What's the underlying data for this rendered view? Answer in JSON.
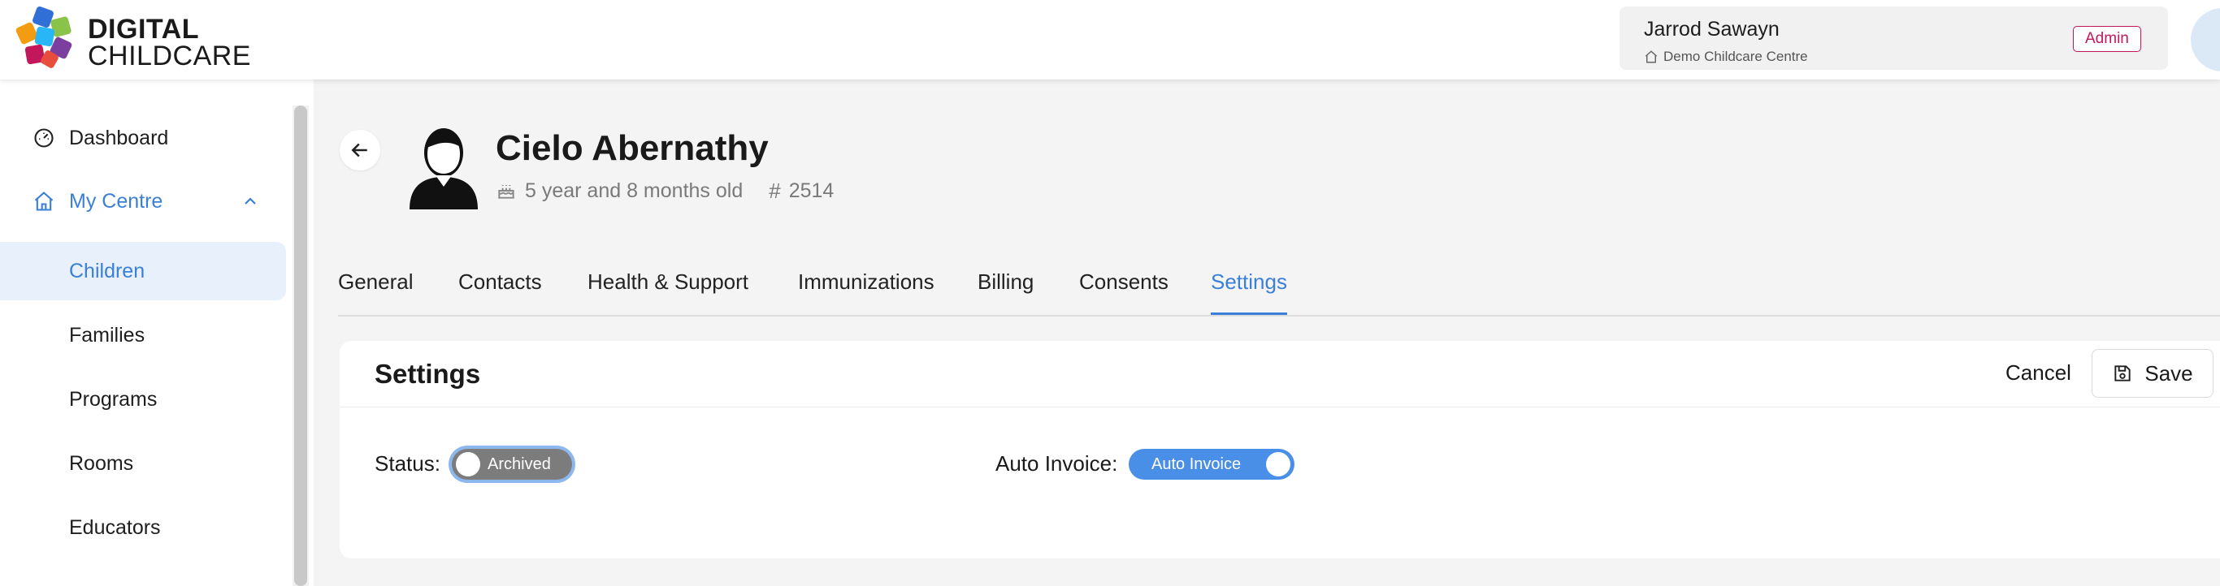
{
  "brand": {
    "line1": "DIGITAL",
    "line2": "CHILDCARE"
  },
  "user": {
    "name": "Jarrod Sawayn",
    "centre": "Demo Childcare Centre",
    "role": "Admin"
  },
  "sidebar": {
    "items": [
      {
        "label": "Dashboard",
        "icon": "gauge-icon"
      },
      {
        "label": "My Centre",
        "icon": "home-icon",
        "expanded": true
      },
      {
        "label": "Children",
        "active": true
      },
      {
        "label": "Families"
      },
      {
        "label": "Programs"
      },
      {
        "label": "Rooms"
      },
      {
        "label": "Educators"
      }
    ]
  },
  "child": {
    "name": "Cielo Abernathy",
    "age": "5 year and 8 months old",
    "id": "2514"
  },
  "tabs": [
    {
      "label": "General"
    },
    {
      "label": "Contacts"
    },
    {
      "label": "Health & Support"
    },
    {
      "label": "Immunizations"
    },
    {
      "label": "Billing"
    },
    {
      "label": "Consents"
    },
    {
      "label": "Settings",
      "active": true
    }
  ],
  "settings": {
    "title": "Settings",
    "cancel_label": "Cancel",
    "save_label": "Save",
    "status_label": "Status",
    "status_value": "Archived",
    "status_on": false,
    "auto_invoice_label": "Auto Invoice",
    "auto_invoice_value": "Auto Invoice",
    "auto_invoice_on": true
  },
  "colors": {
    "accent": "#3a7fd8",
    "badge": "#c2185b",
    "toggle_on": "#4a8fe7",
    "toggle_off": "#7c7c7c"
  }
}
